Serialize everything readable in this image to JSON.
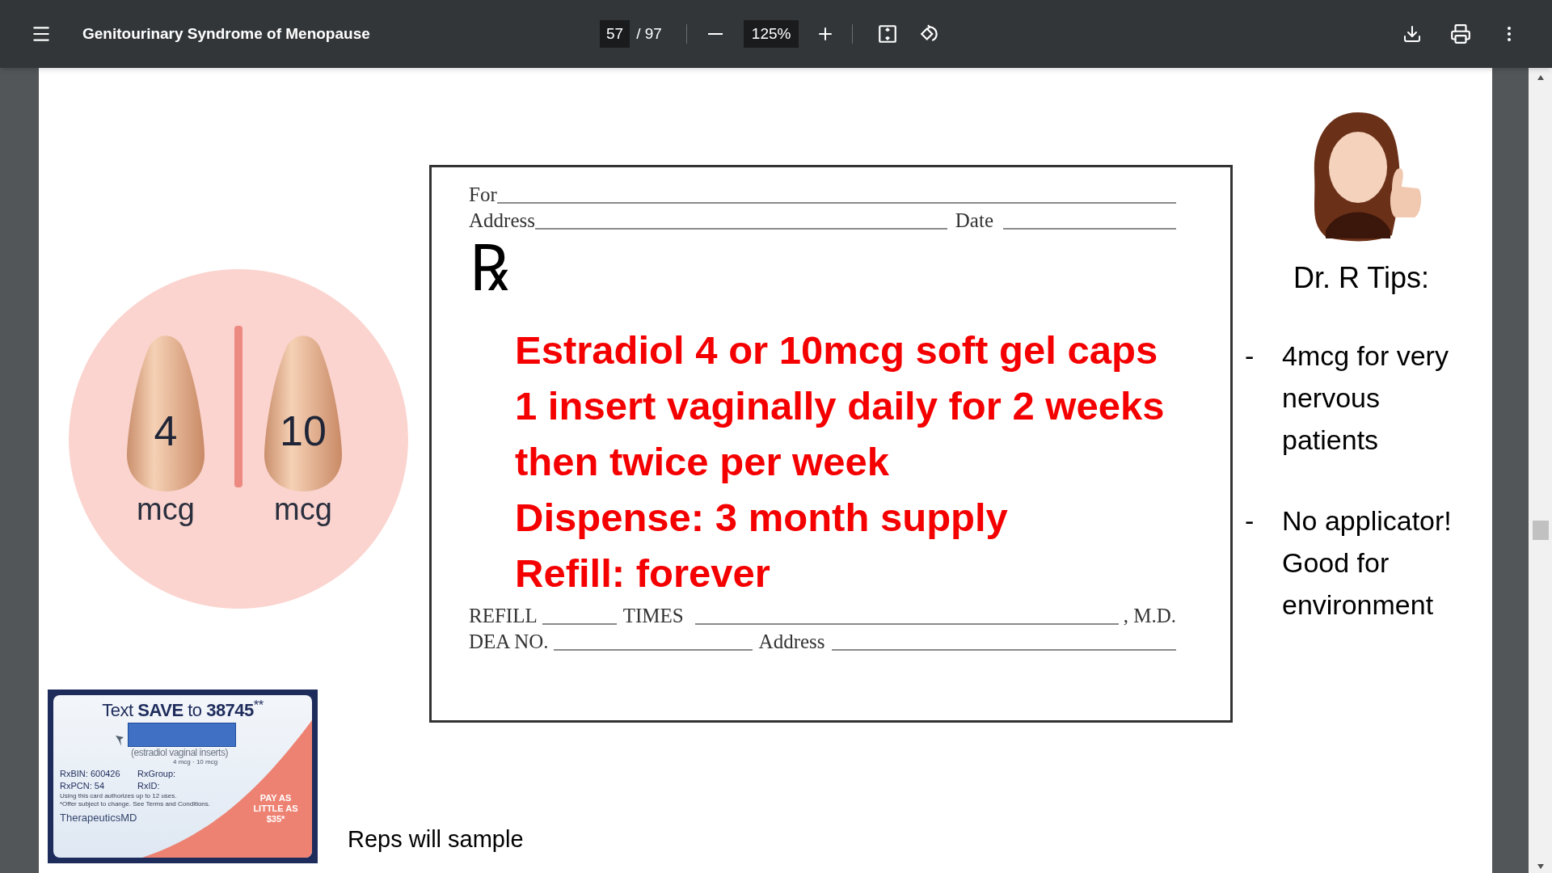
{
  "viewer": {
    "title": "Genitourinary Syndrome of Menopause",
    "page": "57",
    "page_count": "/ 97",
    "zoom": "125%"
  },
  "pills": [
    {
      "dose": "4",
      "unit": "mcg"
    },
    {
      "dose": "10",
      "unit": "mcg"
    }
  ],
  "prescription": {
    "for_label": "For",
    "address_label": "Address",
    "date_label": "Date",
    "symbol": "℞",
    "lines": [
      "Estradiol 4 or 10mcg soft gel caps",
      "1 insert vaginally daily for 2 weeks",
      "then twice per week",
      "Dispense: 3 month supply",
      "Refill: forever"
    ],
    "refill_label": "REFILL",
    "times_label": "TIMES",
    "md_label": ", M.D.",
    "dea_label": "DEA NO.",
    "dea_address_label": "Address"
  },
  "coupon": {
    "headline": "Text **SAVE** to **38745**$^{**}$",
    "product": "(estradiol vaginal inserts)",
    "strengths": "4 mcg · 10 mcg",
    "fields": [
      "RxBIN: 600426",
      "RxGroup:",
      "RxPCN: 54",
      "RxID:"
    ],
    "fine_print": [
      "Using this card authorizes up to 12 uses.",
      "*Offer subject to change. See Terms and Conditions."
    ],
    "brand": "TherapeuticsMD",
    "offer": "PAY AS LITTLE AS $35*"
  },
  "caption": "Reps will sample",
  "tips": {
    "title": "Dr. R Tips:",
    "items": [
      {
        "marker": "-",
        "text": "4mcg for very nervous patients"
      },
      {
        "marker": "-",
        "text": "No applicator! Good for environment"
      }
    ]
  }
}
